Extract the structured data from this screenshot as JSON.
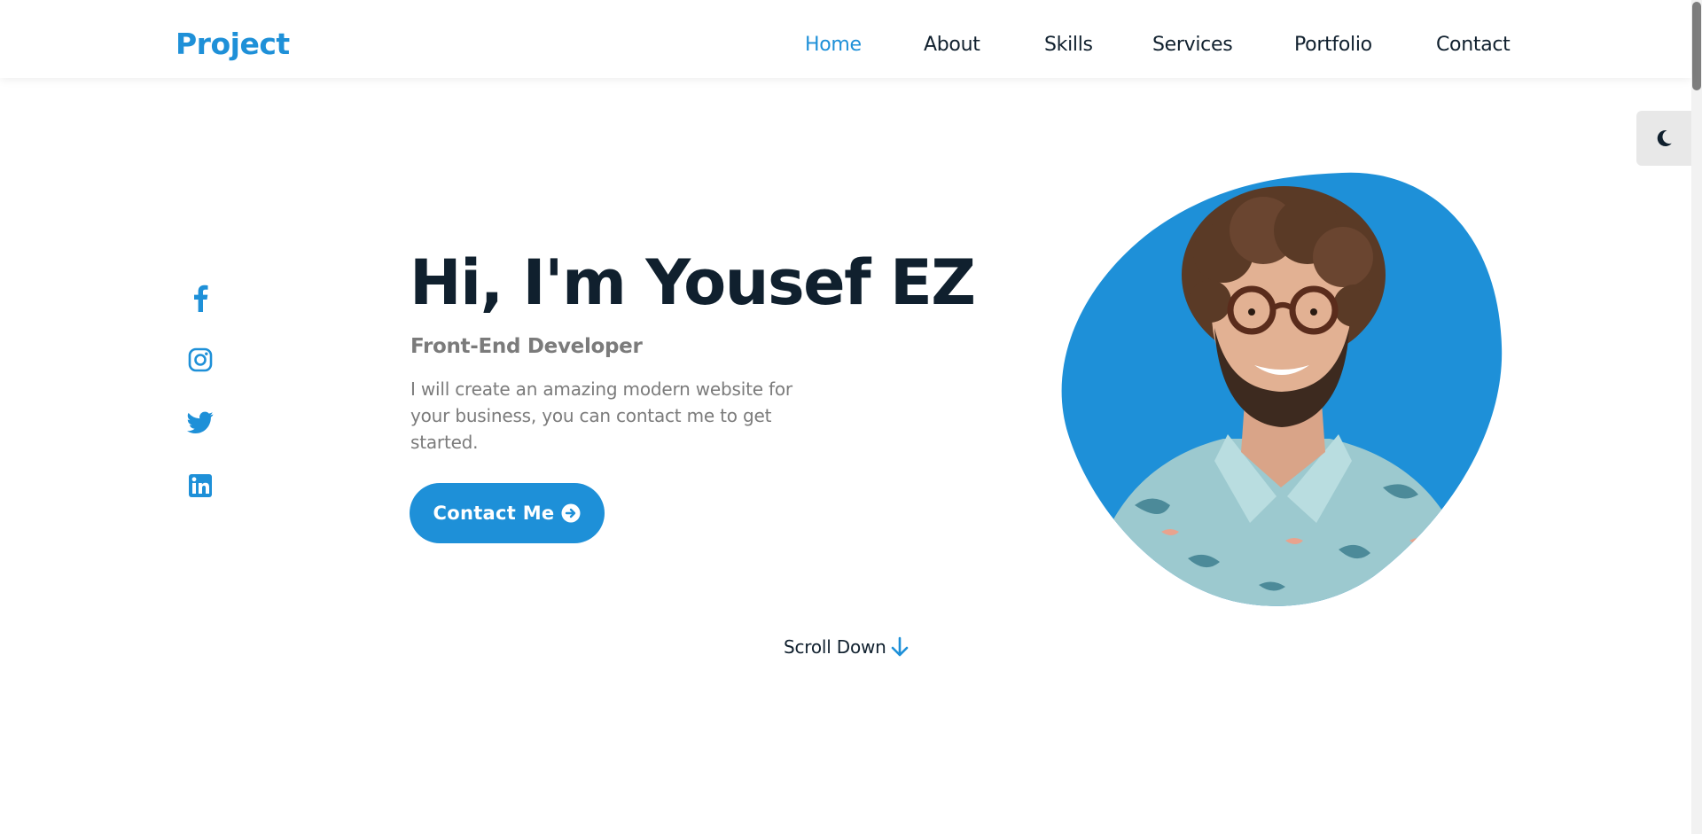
{
  "header": {
    "logo": "Project",
    "nav": [
      {
        "label": "Home",
        "active": true
      },
      {
        "label": "About",
        "active": false
      },
      {
        "label": "Skills",
        "active": false
      },
      {
        "label": "Services",
        "active": false
      },
      {
        "label": "Portfolio",
        "active": false
      },
      {
        "label": "Contact",
        "active": false
      }
    ]
  },
  "theme_toggle": {
    "icon": "moon-icon"
  },
  "social": [
    {
      "icon": "facebook-icon"
    },
    {
      "icon": "instagram-icon"
    },
    {
      "icon": "twitter-icon"
    },
    {
      "icon": "linkedin-icon"
    }
  ],
  "hero": {
    "title": "Hi, I'm Yousef EZ",
    "subtitle": "Front-End Developer",
    "description": "I will create an amazing modern website for your business, you can contact me to get started.",
    "button_label": "Contact Me",
    "button_icon": "arrow-circle-right-icon",
    "image": "profile-photo"
  },
  "scroll_down": {
    "label": "Scroll Down",
    "icon": "arrow-down-icon"
  },
  "colors": {
    "accent": "#1e90d8",
    "text_dark": "#10202e",
    "text_muted": "#7b7b7b",
    "toggle_bg": "#e8e8e8"
  }
}
